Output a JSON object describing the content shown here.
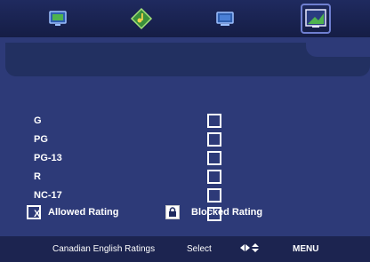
{
  "menu_icons": [
    {
      "name": "picture-menu-icon",
      "selected": false
    },
    {
      "name": "audio-menu-icon",
      "selected": false
    },
    {
      "name": "channel-menu-icon",
      "selected": false
    },
    {
      "name": "parental-lock-menu-icon",
      "selected": true
    }
  ],
  "ratings": [
    {
      "label": "G",
      "blocked": false
    },
    {
      "label": "PG",
      "blocked": false
    },
    {
      "label": "PG-13",
      "blocked": false
    },
    {
      "label": "R",
      "blocked": false
    },
    {
      "label": "NC-17",
      "blocked": false
    },
    {
      "label": "X",
      "blocked": false
    }
  ],
  "legend": {
    "allowed_label": "Allowed Rating",
    "blocked_label": "Blocked Rating"
  },
  "footer": {
    "title": "Canadian English Ratings",
    "select_label": "Select",
    "nav_icons": "arrow-keys-icon",
    "menu_label": "MENU"
  },
  "colors": {
    "background": "#2d3a78",
    "panel": "#223061",
    "topbar": "#1f2a5f",
    "footer": "#1c2450",
    "text": "#ffffff"
  }
}
